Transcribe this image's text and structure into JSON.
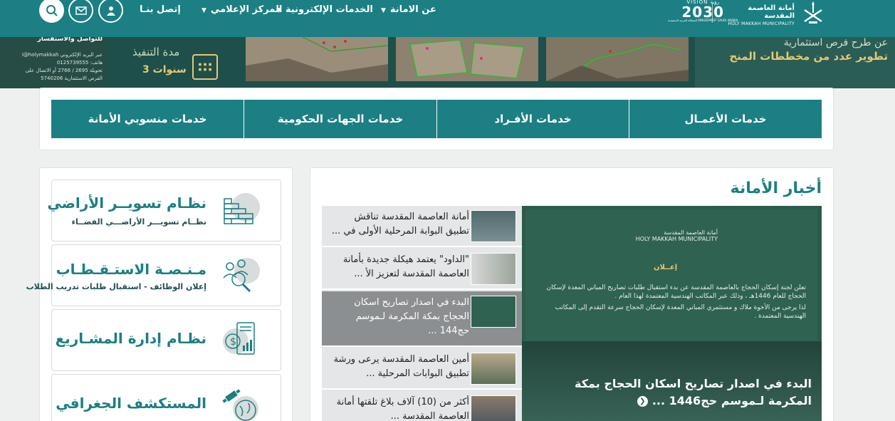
{
  "header": {
    "nav": {
      "contact": "إتصل بنـا",
      "media": "المركز الإعلامي",
      "eservices": "الخدمات الإلكترونية",
      "about": "عن الامانة"
    },
    "logo": {
      "vision_top": "VISION رؤية",
      "vision_year": "2030",
      "vision_sub": "المملكة العربية السعودية KINGDOM OF SAUDI ARABIA",
      "muni_ar": "أمانة العاصمة المقدسة",
      "muni_en": "HOLY MAKKAH MUNICIPALITY"
    },
    "icons": [
      "search-icon",
      "mail-icon",
      "user-icon"
    ],
    "colors": {
      "primary": "#1b7f83",
      "accent": "#e8c770"
    }
  },
  "banner": {
    "contact_title": "للتواصل والاستفسار",
    "contact_lines": [
      "عبر البريد الإلكتروني i@holymakkah",
      "هاتف: 0125739555",
      "تحويلة 2695 / 2766 أو الاتصال على",
      "الفرص الاستثمارية 5740206"
    ],
    "duration_label": "مدة التنفيذ",
    "duration_value": "3 سنوات",
    "headline_1": "عن طرح فرص استثمارية",
    "headline_2": "تطوير عدد من مخططات المنح"
  },
  "services": {
    "business": "خدمات الأعمـال",
    "individuals": "خدمات الأفـراد",
    "government": "خدمات الجهات الحكومية",
    "employees": "خدمات منسوبي الأمانة"
  },
  "systems": [
    {
      "title": "نظـام تسويــر الأراضي",
      "subtitle": "نظــام تسويـــر الأراضـــي الفضــاء"
    },
    {
      "title": "مـنـصـة الاستـقـطـاب",
      "subtitle": "إعلان الوظائف - استقبال طلبات تدريب الطلاب"
    },
    {
      "title": "نظـام إدارة المشـاريع",
      "subtitle": ""
    },
    {
      "title": "المستكشف الجغرافي",
      "subtitle": ""
    }
  ],
  "news": {
    "title": "أخبار الأمانة",
    "items": [
      "أمانة العاصمة المقدسة تناقش تطبيق البوابة المرحلية الأولى في ...",
      "\"الداود\" يعتمد هيكلة جديدة بأمانة العاصمة المقدسة لتعزيز الأ ...",
      "البدء في اصدار تصاريح اسكان الحجاج بمكة المكرمة لـموسم حج144 ...",
      "أمين العاصمة المقدسة يرعى ورشة تطبيق البوابات المرحلية ...",
      "أكثر من (10) آلاف بلاغ تلقتها أمانة العاصمة المقدسة ..."
    ],
    "active_index": 2,
    "feature": {
      "doc_logo_ar": "أمانة العاصمة المقدسة",
      "doc_logo_en": "HOLY MAKKAH MUNICIPALITY",
      "doc_heading": "إعــلان",
      "doc_body_1": "تعلن لجنة إسكان الحجاج بالعاصمة المقدسة عن بدء استقبال طلبات تصاريح المباني المعدة لإسكان الحجاج للعام 1446هـ ، وذلك عبر المكاتب الهندسية المعتمدة لهذا العام .",
      "doc_body_2": "لذا يرجى من الأخوة ملاك و مستثمري المباني المعدة لإسكان الحجاج سرعة التقدم إلى المكاتب الهندسية المعتمدة .",
      "caption": "البدء في اصدار تصاريح اسكان الحجاج بمكة المكرمة لـموسم حج1446 ..."
    }
  }
}
